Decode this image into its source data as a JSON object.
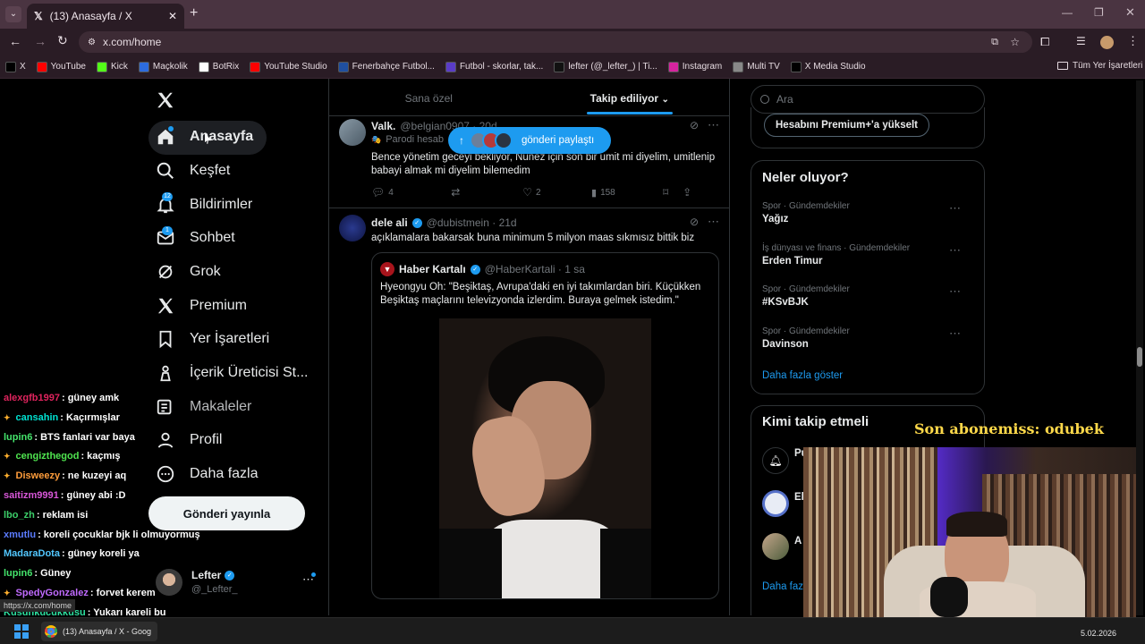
{
  "browser": {
    "tab_title": "(13) Anasayfa / X",
    "url": "x.com/home",
    "new_tab_label": "+",
    "bookmarks": [
      {
        "label": "X",
        "color": "#000000"
      },
      {
        "label": "YouTube",
        "color": "#ff0000"
      },
      {
        "label": "Kick",
        "color": "#53fc18"
      },
      {
        "label": "Maçkolik",
        "color": "#2d6cdf"
      },
      {
        "label": "BotRix",
        "color": "#ffffff"
      },
      {
        "label": "YouTube Studio",
        "color": "#ff0000"
      },
      {
        "label": "Fenerbahçe Futbol...",
        "color": "#1f4fa0"
      },
      {
        "label": "Futbol - skorlar, tak...",
        "color": "#5a3cc7"
      },
      {
        "label": "lefter (@_lefter_) | Ti...",
        "color": "#111111"
      },
      {
        "label": "Instagram",
        "color": "#d6249f"
      },
      {
        "label": "Multi TV",
        "color": "#888888"
      },
      {
        "label": "X Media Studio",
        "color": "#000000"
      }
    ],
    "all_bookmarks": "Tüm Yer İşaretleri",
    "status_url": "https://x.com/home"
  },
  "nav": {
    "items": [
      {
        "label": "Anasayfa",
        "icon": "home-icon"
      },
      {
        "label": "Keşfet",
        "icon": "search-icon"
      },
      {
        "label": "Bildirimler",
        "icon": "bell-icon",
        "badge": "12"
      },
      {
        "label": "Sohbet",
        "icon": "mail-icon",
        "badge": "1"
      },
      {
        "label": "Grok",
        "icon": "grok-icon"
      },
      {
        "label": "Premium",
        "icon": "x-logo-icon"
      },
      {
        "label": "Yer İşaretleri",
        "icon": "bookmark-icon"
      },
      {
        "label": "İçerik Üreticisi St...",
        "icon": "creator-studio-icon"
      },
      {
        "label": "Makaleler",
        "icon": "articles-icon"
      },
      {
        "label": "Profil",
        "icon": "profile-icon"
      },
      {
        "label": "Daha fazla",
        "icon": "more-circle-icon"
      }
    ],
    "post_button": "Gönderi yayınla",
    "account": {
      "name": "Lefter",
      "handle": "@_Lefter_"
    }
  },
  "feed": {
    "tabs": [
      "Sana özel",
      "Takip ediliyor"
    ],
    "new_posts_pill": "gönderi paylaştı",
    "tweets": [
      {
        "name": "Valk.",
        "handle": "@belgian0907 · 20d",
        "label": "Parodi hesab",
        "text": "Bence yönetim geceyi bekliyor, Nunez için son bir umit mi diyelim, umitlenip babayi almak mi diyelim bilemedim",
        "replies": "4",
        "retweets": "",
        "likes": "2",
        "views": "158"
      },
      {
        "name": "dele ali",
        "handle": "@dubistmein · 21d",
        "text": "açıklamalara bakarsak buna minimum 5 milyon maas sıkmısız bittik biz",
        "quote": {
          "name": "Haber Kartalı",
          "handle": "@HaberKartali · 1 sa",
          "text": "Hyeongyu Oh: \"Beşiktaş, Avrupa'daki en iyi takımlardan biri. Küçükken Beşiktaş maçlarını televizyonda izlerdim. Buraya gelmek istedim.\""
        }
      }
    ]
  },
  "right": {
    "search_placeholder": "Ara",
    "premium_button": "Hesabını Premium+'a yükselt",
    "trends_title": "Neler oluyor?",
    "trends": [
      {
        "category": "Spor · Gündemdekiler",
        "name": "Yağız"
      },
      {
        "category": "İş dünyası ve finans · Gündemdekiler",
        "name": "Erden Timur"
      },
      {
        "category": "Spor · Gündemdekiler",
        "name": "#KSvBJK"
      },
      {
        "category": "Spor · Gündemdekiler",
        "name": "Davinson"
      }
    ],
    "show_more": "Daha fazla göster",
    "who_to_follow_title": "Kimi takip etmeli",
    "follow_suggestions": [
      "Pu",
      "El",
      "A"
    ],
    "show_more_2": "Daha faz"
  },
  "stream": {
    "subscriber_banner": "Son abonemiss: odubek",
    "chat": [
      {
        "user": "alexgfb1997",
        "color": "#e0245e",
        "msg": ": güney amk",
        "badge": false
      },
      {
        "user": "cansahin",
        "color": "#00e0d0",
        "msg": ": Kaçırmışlar",
        "badge": true
      },
      {
        "user": "lupin6",
        "color": "#44e36b",
        "msg": ": BTS fanlari var baya",
        "badge": false
      },
      {
        "user": "cengizthegod",
        "color": "#4fe44f",
        "msg": ": kaçmış",
        "badge": true
      },
      {
        "user": "Disweezy",
        "color": "#ff9d3b",
        "msg": ": ne kuzeyi aq",
        "badge": true
      },
      {
        "user": "saitizm9991",
        "color": "#d957d9",
        "msg": ": güney abi :D",
        "badge": false
      },
      {
        "user": "lbo_zh",
        "color": "#3ccf6a",
        "msg": ": reklam isi",
        "badge": false
      },
      {
        "user": "xmutlu",
        "color": "#5b7cff",
        "msg": ": koreli çocuklar bjk li olmuyormuş",
        "badge": false
      },
      {
        "user": "MadaraDota",
        "color": "#52c7ff",
        "msg": ": güney koreli ya",
        "badge": false
      },
      {
        "user": "lupin6",
        "color": "#44e36b",
        "msg": ": Güney",
        "badge": false
      },
      {
        "user": "SpedyGonzalez",
        "color": "#c06bff",
        "msg": ": forvet kerem",
        "badge": true
      },
      {
        "user": "Kusunkucukkusu",
        "color": "#2ee0a0",
        "msg": ": Yukarı kareli bu",
        "badge": false
      }
    ]
  },
  "taskbar": {
    "window_title": "(13) Anasayfa / X - Goog",
    "date": "5.02.2026"
  },
  "colors": {
    "accent": "#1d9bf0",
    "chrome": "#4a3441",
    "banner_text": "#ffd94a"
  }
}
